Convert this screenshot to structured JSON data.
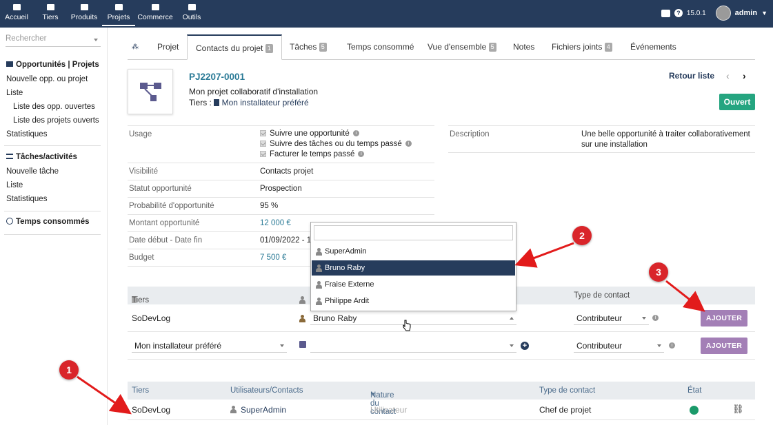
{
  "topnav": [
    {
      "label": "Accueil"
    },
    {
      "label": "Tiers"
    },
    {
      "label": "Produits"
    },
    {
      "label": "Projets"
    },
    {
      "label": "Commerce"
    },
    {
      "label": "Outils"
    }
  ],
  "topright": {
    "version": "15.0.1",
    "user": "admin"
  },
  "sidebar": {
    "search_placeholder": "Rechercher",
    "section1": "Opportunités | Projets",
    "s1_new": "Nouvelle opp. ou projet",
    "s1_list": "Liste",
    "s1_open_opp": "Liste des opp. ouvertes",
    "s1_open_proj": "Liste des projets ouverts",
    "s1_stats": "Statistiques",
    "section2": "Tâches/activités",
    "s2_new": "Nouvelle tâche",
    "s2_list": "Liste",
    "s2_stats": "Statistiques",
    "section3": "Temps consommés"
  },
  "tabs": {
    "projet": "Projet",
    "contacts": "Contacts du projet",
    "contacts_n": "1",
    "taches": "Tâches",
    "taches_n": "5",
    "temps": "Temps consommé",
    "vue": "Vue d'ensemble",
    "vue_n": "5",
    "notes": "Notes",
    "fichiers": "Fichiers joints",
    "fichiers_n": "4",
    "events": "Événements"
  },
  "project": {
    "ref": "PJ2207-0001",
    "title": "Mon projet collaboratif d'installation",
    "tiers_label": "Tiers :",
    "tiers_name": "Mon installateur préféré",
    "status": "Ouvert",
    "retour": "Retour liste"
  },
  "fields": {
    "usage_label": "Usage",
    "usage_opt1": "Suivre une opportunité",
    "usage_opt2": "Suivre des tâches ou du temps passé",
    "usage_opt3": "Facturer le temps passé",
    "visibilite_label": "Visibilité",
    "visibilite": "Contacts projet",
    "statut_label": "Statut opportunité",
    "statut": "Prospection",
    "proba_label": "Probabilité d'opportunité",
    "proba": "95 %",
    "montant_label": "Montant opportunité",
    "montant": "12 000 €",
    "dates_label": "Date début - Date fin",
    "dates": "01/09/2022 - 1",
    "budget_label": "Budget",
    "budget": "7 500 €",
    "desc_label": "Description",
    "desc": "Une belle opportunité à traiter collaborativement sur une installation"
  },
  "add_table": {
    "col_tiers": "Tiers",
    "col_type": "Type de contact",
    "row1": {
      "tiers": "SoDevLog",
      "user": "Bruno Raby",
      "type": "Contributeur",
      "btn": "AJOUTER"
    },
    "row2": {
      "tiers": "Mon installateur préféré",
      "type": "Contributeur",
      "btn": "AJOUTER"
    }
  },
  "dropdown": {
    "options": [
      {
        "label": "SuperAdmin"
      },
      {
        "label": "Bruno Raby"
      },
      {
        "label": "Fraise Externe"
      },
      {
        "label": "Philippe Ardit"
      }
    ]
  },
  "list_table": {
    "col_tiers": "Tiers",
    "col_users": "Utilisateurs/Contacts",
    "col_nature": "Nature du contact",
    "col_type": "Type de contact",
    "col_state": "État",
    "row": {
      "tiers": "SoDevLog",
      "user": "SuperAdmin",
      "nature": "Utilisateur",
      "type": "Chef de projet"
    }
  },
  "annotations": {
    "a1": "1",
    "a2": "2",
    "a3": "3"
  }
}
